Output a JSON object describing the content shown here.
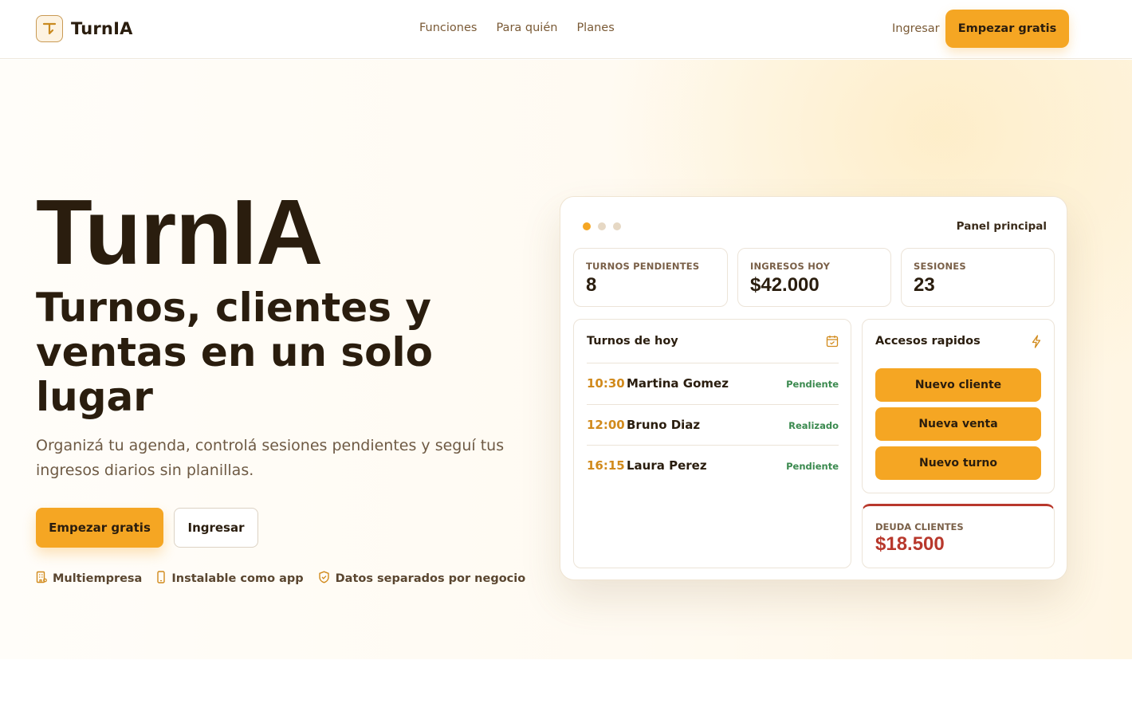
{
  "header": {
    "brand_name": "TurnIA",
    "nav": [
      {
        "label": "Funciones"
      },
      {
        "label": "Para quién"
      },
      {
        "label": "Planes"
      }
    ],
    "login_label": "Ingresar",
    "cta_label": "Empezar gratis"
  },
  "hero": {
    "title": "TurnIA",
    "subtitle": "Turnos, clientes y ventas en un solo lugar",
    "description": "Organizá tu agenda, controlá sesiones pendientes y seguí tus ingresos diarios sin planillas.",
    "primary_cta": "Empezar gratis",
    "secondary_cta": "Ingresar",
    "features": [
      {
        "icon": "building-icon",
        "label": "Multiempresa"
      },
      {
        "icon": "phone-icon",
        "label": "Instalable como app"
      },
      {
        "icon": "shield-icon",
        "label": "Datos separados por negocio"
      }
    ]
  },
  "panel": {
    "title": "Panel principal",
    "dot_colors": [
      "#f5a623",
      "#e6d8c4",
      "#e6d8c4"
    ],
    "stats": [
      {
        "label": "TURNOS PENDIENTES",
        "value": "8"
      },
      {
        "label": "INGRESOS HOY",
        "value": "$42.000"
      },
      {
        "label": "SESIONES",
        "value": "23"
      }
    ],
    "appointments": {
      "title": "Turnos de hoy",
      "icon": "calendar-icon",
      "rows": [
        {
          "time": "10:30",
          "name": "Martina Gomez",
          "status": "Pendiente"
        },
        {
          "time": "12:00",
          "name": "Bruno Diaz",
          "status": "Realizado"
        },
        {
          "time": "16:15",
          "name": "Laura Perez",
          "status": "Pendiente"
        }
      ]
    },
    "quick_access": {
      "title": "Accesos rapidos",
      "icon": "lightning-icon",
      "buttons": [
        {
          "label": "Nuevo cliente"
        },
        {
          "label": "Nueva venta"
        },
        {
          "label": "Nuevo turno"
        }
      ]
    },
    "debt": {
      "label": "DEUDA CLIENTES",
      "value": "$18.500",
      "color": "#b8382c"
    }
  },
  "colors": {
    "accent": "#f5a623",
    "text_dark": "#2a1d0e",
    "status_green": "#3b8a4f",
    "debt_red": "#b8382c"
  }
}
